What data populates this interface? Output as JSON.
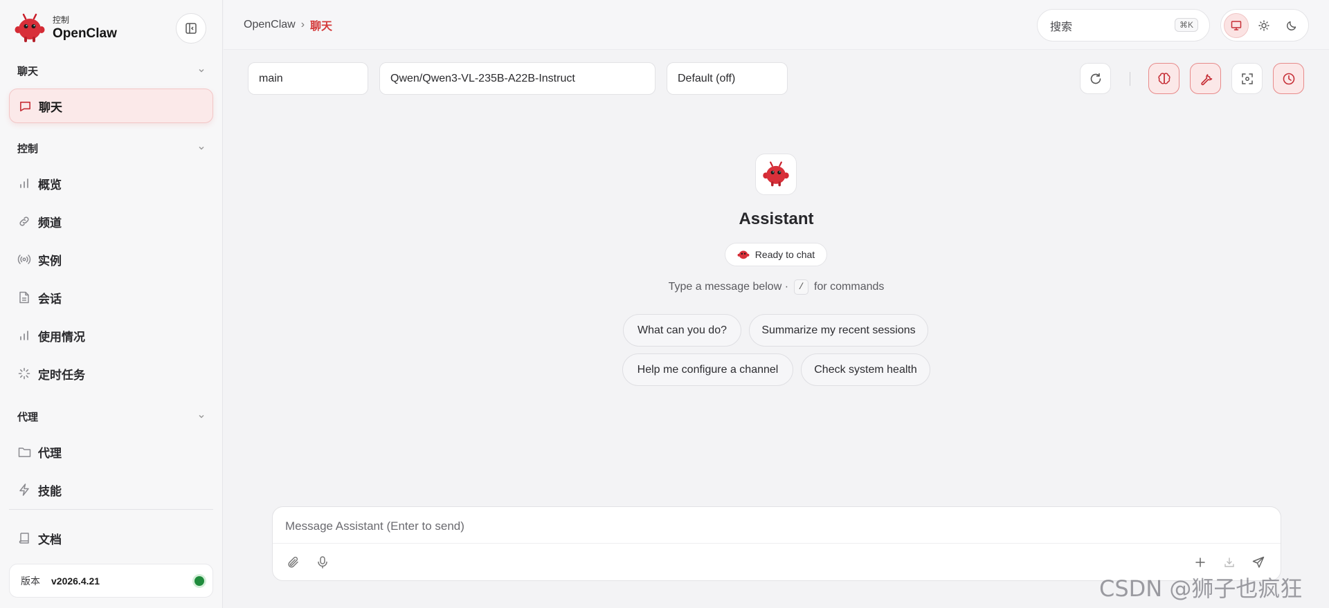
{
  "app": {
    "brand_sub": "控制",
    "brand_title": "OpenClaw"
  },
  "sidebar": {
    "sections": [
      {
        "label": "聊天"
      },
      {
        "label": "控制"
      },
      {
        "label": "代理"
      }
    ],
    "items": [
      {
        "label": "聊天",
        "icon": "message-square-icon",
        "active": true
      },
      {
        "label": "概览",
        "icon": "bar-chart-icon"
      },
      {
        "label": "频道",
        "icon": "link-icon"
      },
      {
        "label": "实例",
        "icon": "radio-icon"
      },
      {
        "label": "会话",
        "icon": "file-text-icon"
      },
      {
        "label": "使用情况",
        "icon": "bar-chart-icon"
      },
      {
        "label": "定时任务",
        "icon": "loader-icon"
      },
      {
        "label": "代理",
        "icon": "folder-icon"
      },
      {
        "label": "技能",
        "icon": "zap-icon"
      },
      {
        "label": "文档",
        "icon": "book-icon"
      }
    ],
    "version": {
      "label": "版本",
      "value": "v2026.4.21",
      "status_color": "#1f8b3c"
    }
  },
  "header": {
    "breadcrumb": {
      "root": "OpenClaw",
      "separator": "›",
      "current": "聊天"
    },
    "search": {
      "placeholder": "搜索",
      "shortcut": "⌘K"
    },
    "theme": {
      "selected": "system"
    }
  },
  "toolbar": {
    "agent": "main",
    "model": "Qwen/Qwen3-VL-235B-A22B-Instruct",
    "thinking": "Default (off)"
  },
  "hero": {
    "title": "Assistant",
    "status": "Ready to chat",
    "hint_before": "Type a message below ·",
    "hint_key": "/",
    "hint_after": "for commands",
    "suggestions": [
      "What can you do?",
      "Summarize my recent sessions",
      "Help me configure a channel",
      "Check system health"
    ]
  },
  "composer": {
    "placeholder": "Message Assistant (Enter to send)"
  },
  "watermark": "CSDN @狮子也疯狂",
  "colors": {
    "accent": "#d43a3a",
    "accent_bg": "#fbe8e8"
  }
}
